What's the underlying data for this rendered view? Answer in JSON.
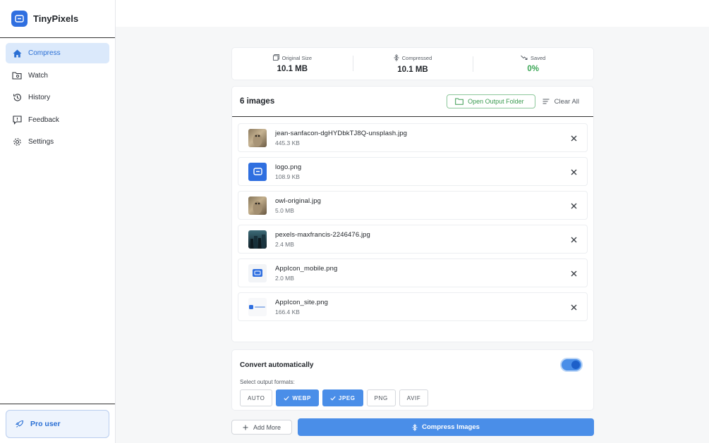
{
  "app": {
    "name": "TinyPixels",
    "accent": "#2f6fe0"
  },
  "sidebar": {
    "items": [
      {
        "label": "Compress",
        "icon": "home-icon",
        "active": true
      },
      {
        "label": "Watch",
        "icon": "folder-watch-icon"
      },
      {
        "label": "History",
        "icon": "history-icon"
      },
      {
        "label": "Feedback",
        "icon": "feedback-icon"
      },
      {
        "label": "Settings",
        "icon": "gear-icon"
      }
    ],
    "pro_label": "Pro user"
  },
  "stats": {
    "original": {
      "label": "Original Size",
      "value": "10.1 MB"
    },
    "compressed": {
      "label": "Compressed",
      "value": "10.1 MB"
    },
    "saved": {
      "label": "Saved",
      "value": "0%",
      "color": "#3aa655"
    }
  },
  "images": {
    "count_label": "6 images",
    "open_folder_label": "Open Output Folder",
    "clear_all_label": "Clear All",
    "files": [
      {
        "name": "jean-sanfacon-dgHYDbkTJ8Q-unsplash.jpg",
        "size": "445.3 KB",
        "thumb": "owl-photo"
      },
      {
        "name": "logo.png",
        "size": "108.9 KB",
        "thumb": "app-logo"
      },
      {
        "name": "owl-original.jpg",
        "size": "5.0 MB",
        "thumb": "owl-photo"
      },
      {
        "name": "pexels-maxfrancis-2246476.jpg",
        "size": "2.4 MB",
        "thumb": "city-photo"
      },
      {
        "name": "AppIcon_mobile.png",
        "size": "2.0 MB",
        "thumb": "mobile-icon"
      },
      {
        "name": "AppIcon_site.png",
        "size": "166.4 KB",
        "thumb": "site-icon"
      }
    ]
  },
  "convert": {
    "title": "Convert automatically",
    "enabled": true,
    "formats_label": "Select output formats:",
    "formats": [
      {
        "label": "AUTO",
        "selected": false
      },
      {
        "label": "WEBP",
        "selected": true
      },
      {
        "label": "JPEG",
        "selected": true
      },
      {
        "label": "PNG",
        "selected": false
      },
      {
        "label": "AVIF",
        "selected": false
      }
    ]
  },
  "actions": {
    "add_more_label": "Add More",
    "compress_label": "Compress Images"
  }
}
